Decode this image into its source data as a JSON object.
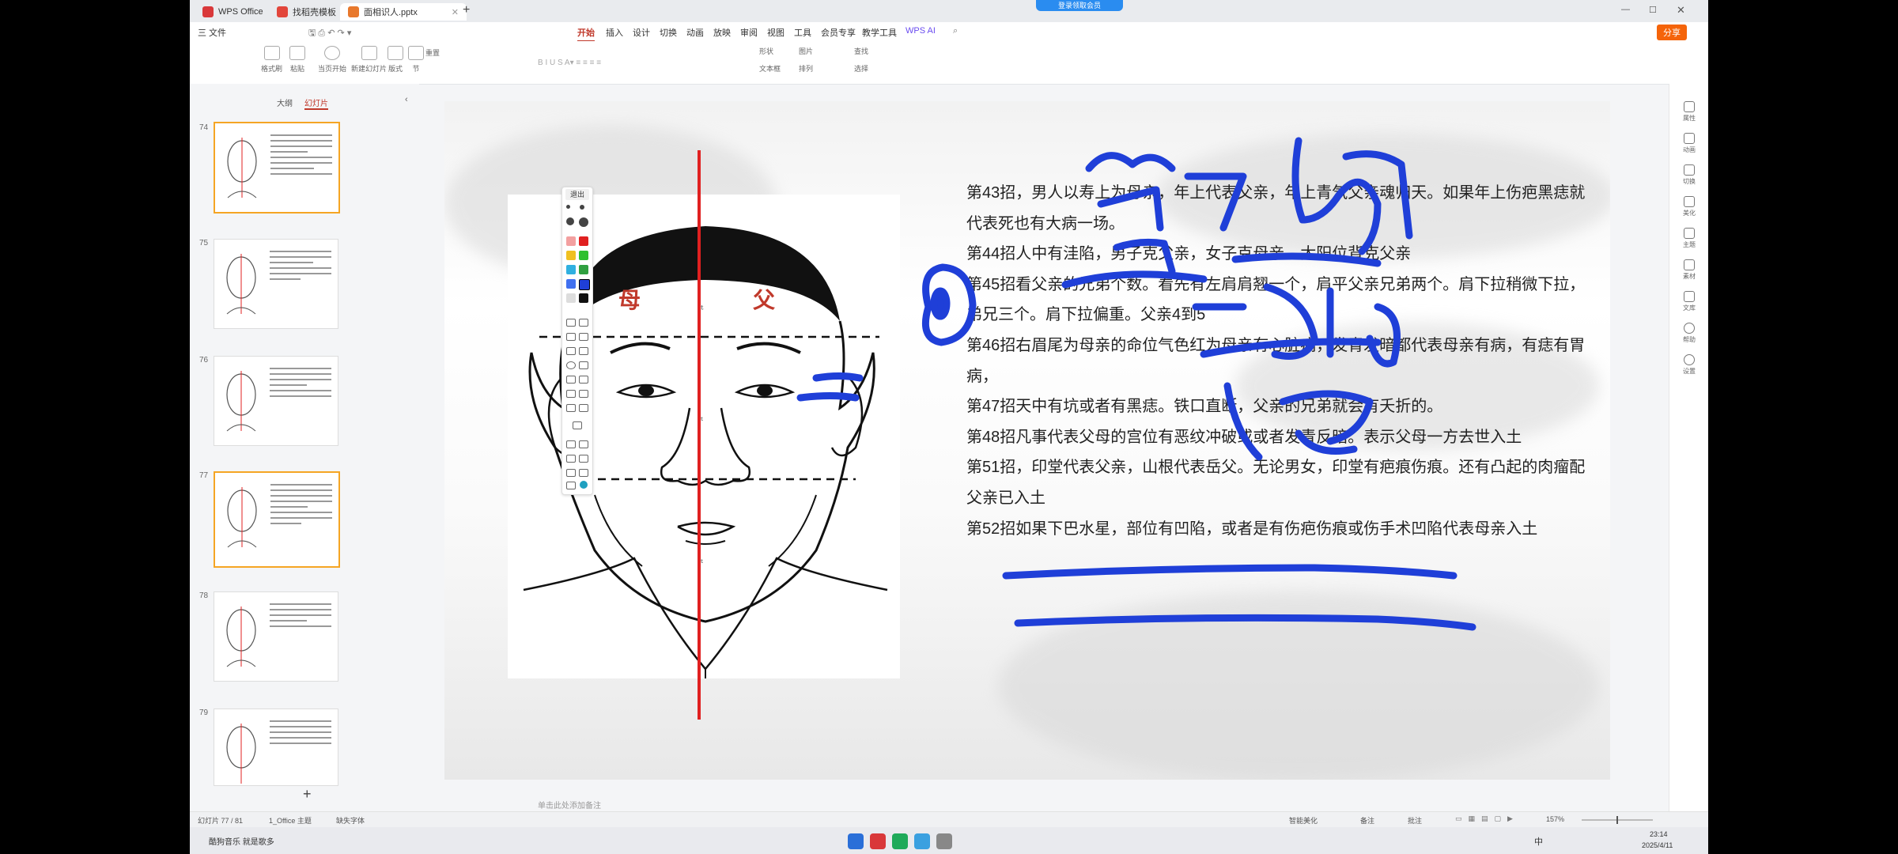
{
  "titlebar": {
    "tabs": [
      {
        "label": "WPS Office"
      },
      {
        "label": "找稻壳模板"
      },
      {
        "label": "面相识人.pptx"
      }
    ],
    "plus": "+",
    "badge": "登录领取会员"
  },
  "menubar": {
    "file": "三 文件",
    "items": [
      "开始",
      "插入",
      "设计",
      "切换",
      "动画",
      "放映",
      "审阅",
      "视图",
      "工具",
      "会员专享",
      "教学工具",
      "WPS AI"
    ],
    "share": "分享"
  },
  "ribbon": {
    "labels": [
      "格式刷",
      "粘贴",
      "当页开始",
      "新建幻灯片",
      "版式",
      "节",
      "重置",
      "形状",
      "图片",
      "文本框",
      "排列",
      "查找",
      "选择"
    ]
  },
  "sidebar": {
    "tabs": [
      "大纲",
      "幻灯片"
    ],
    "slides": [
      {
        "num": "74"
      },
      {
        "num": "75"
      },
      {
        "num": "76"
      },
      {
        "num": "77"
      },
      {
        "num": "78"
      },
      {
        "num": "79"
      }
    ],
    "add": "+"
  },
  "pentools": {
    "exit": "退出"
  },
  "slide": {
    "face_labels": {
      "mother": "母",
      "father": "父"
    },
    "paragraphs": [
      "第43招，男人以寿上为母亲，年上代表父亲，年上青气父亲魂归天。如果年上伤疤黑痣就代表死也有大病一场。",
      "第44招人中有洼陷，男子克父亲，女子克母亲。太阳位背克父亲",
      "第45招看父亲的兄弟个数。看先有左肩肩翘一个，肩平父亲兄弟两个。肩下拉稍微下拉，弟兄三个。肩下拉偏重。父亲4到5",
      "第46招右眉尾为母亲的命位气色红为母亲有心脏病，发青发暗都代表母亲有病，有痣有胃病，",
      "第47招天中有坑或者有黑痣。铁口直断，父亲的兄弟就会有夭折的。",
      "第48招凡事代表父母的宫位有恶纹冲破或或者发青反暗。表示父母一方去世入土",
      "第51招，印堂代表父亲，山根代表岳父。无论男女，印堂有疤痕伤痕。还有凸起的肉瘤配父亲已入土",
      "第52招如果下巴水星，部位有凹陷，或者是有伤疤伤痕或伤手术凹陷代表母亲入土"
    ]
  },
  "rightpanel": {
    "items": [
      "属性",
      "动画",
      "切换",
      "美化",
      "主题",
      "素材",
      "文库",
      "帮助",
      "设置"
    ]
  },
  "notes": {
    "placeholder": "单击此处添加备注"
  },
  "statusbar": {
    "slide_count": "幻灯片 77 / 81",
    "theme": "1_Office 主题",
    "font_missing": "缺失字体",
    "beautify": "智能美化",
    "notes_btn": "备注",
    "comments_btn": "批注",
    "zoom": "157%"
  },
  "taskbar": {
    "music": "酷狗音乐 就是歌多",
    "lang": "中",
    "time": "23:14",
    "date": "2025/4/11"
  },
  "colors": {
    "accent": "#c0392b",
    "ink_blue": "#1f3fd8",
    "red_line": "#e02020",
    "selected_border": "#f5a524"
  }
}
